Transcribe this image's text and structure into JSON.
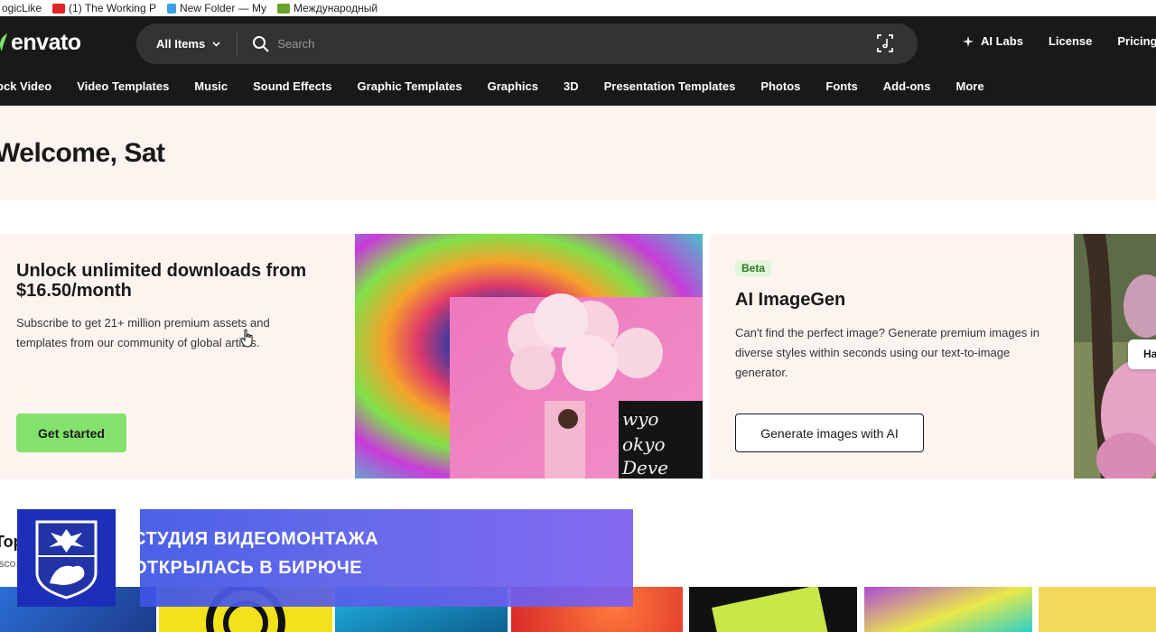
{
  "bookmarks": [
    {
      "label": "ogicLike",
      "icon": "bookmark-icon",
      "color": "#f2a40a"
    },
    {
      "label": "(1) The Working P",
      "icon": "youtube-icon",
      "color": "#e02424"
    },
    {
      "label": "New Folder — My",
      "icon": "folder-icon",
      "color": "#3ca0e6"
    },
    {
      "label": "Международный",
      "icon": "news-icon",
      "color": "#6aa22a"
    }
  ],
  "header": {
    "logo": "envato",
    "search": {
      "scope": "All Items",
      "placeholder": "Search"
    },
    "right": {
      "ai_labs": "AI Labs",
      "license": "License",
      "pricing": "Pricing"
    },
    "categories": [
      "ock Video",
      "Video Templates",
      "Music",
      "Sound Effects",
      "Graphic Templates",
      "Graphics",
      "3D",
      "Presentation Templates",
      "Photos",
      "Fonts",
      "Add-ons",
      "More"
    ]
  },
  "welcome": {
    "title": "Welcome, Sat"
  },
  "promo_subscribe": {
    "title": "Unlock unlimited downloads from $16.50/month",
    "desc": "Subscribe to get 21+ million premium assets and templates from our community of global artists.",
    "button": "Get started"
  },
  "promo_ai": {
    "badge": "Beta",
    "title": "AI ImageGen",
    "desc": "Can't find the perfect image? Generate premium images in diverse styles within seconds using our text-to-image generator.",
    "button": "Generate images with AI",
    "pill": "Ha"
  },
  "section": {
    "title": "Top ...",
    "subtitle": "isco..."
  },
  "overlay": {
    "line1": "СТУДИЯ ВИДЕОМОНТАЖА",
    "line2": "ОТКРЫЛАСЬ В БИРЮЧЕ"
  },
  "colors": {
    "header_bg": "#191919",
    "accent_green": "#82e26b",
    "cream": "#fdf4ef",
    "overlay_blue": "#3d55e6"
  }
}
